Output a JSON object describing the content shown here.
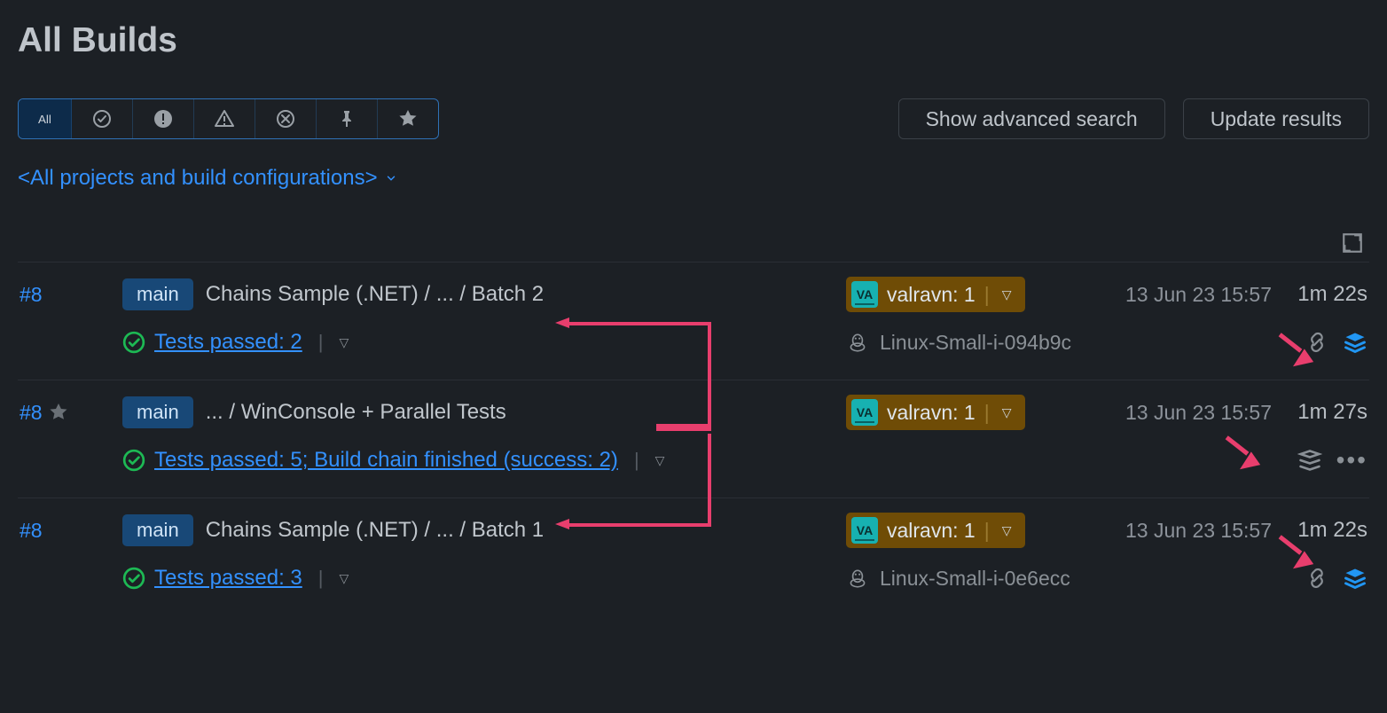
{
  "title": "All Builds",
  "toolbar": {
    "all_label": "All",
    "advanced_search": "Show advanced search",
    "update_results": "Update results"
  },
  "scope": {
    "label": "<All projects and build configurations>"
  },
  "builds": [
    {
      "number": "#8",
      "starred": false,
      "branch": "main",
      "crumb": "Chains Sample (.NET) / ... / Batch 2",
      "status": "Tests passed: 2",
      "user": "valravn: 1",
      "date": "13 Jun 23 15:57",
      "duration": "1m 22s",
      "agent": "Linux-Small-i-094b9c",
      "show_link_icon": true,
      "stack_color": "blue",
      "show_dots": false
    },
    {
      "number": "#8",
      "starred": true,
      "branch": "main",
      "crumb": "... / WinConsole + Parallel Tests",
      "status": "Tests passed: 5; Build chain finished (success: 2)",
      "user": "valravn: 1",
      "date": "13 Jun 23 15:57",
      "duration": "1m 27s",
      "agent": "",
      "show_link_icon": false,
      "stack_color": "gray",
      "show_dots": true
    },
    {
      "number": "#8",
      "starred": false,
      "branch": "main",
      "crumb": "Chains Sample (.NET) / ... / Batch 1",
      "status": "Tests passed: 3",
      "user": "valravn: 1",
      "date": "13 Jun 23 15:57",
      "duration": "1m 22s",
      "agent": "Linux-Small-i-0e6ecc",
      "show_link_icon": true,
      "stack_color": "blue",
      "show_dots": false
    }
  ]
}
